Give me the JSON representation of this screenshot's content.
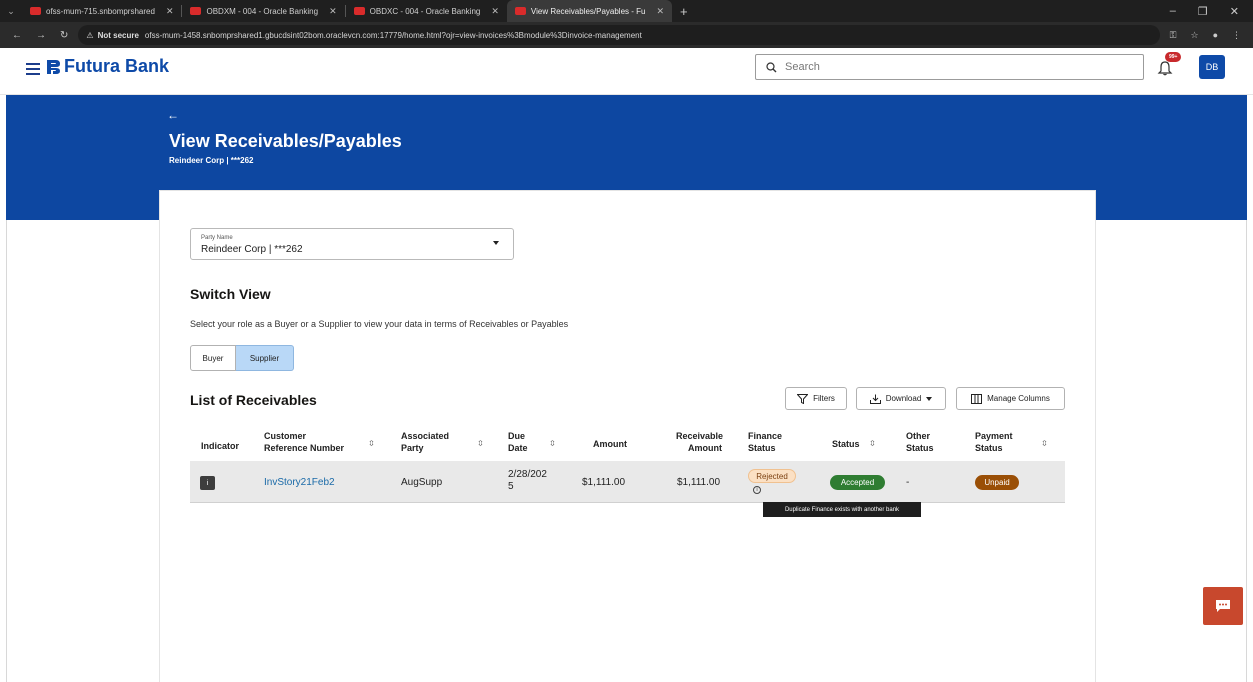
{
  "browser": {
    "tabs": [
      {
        "title": "ofss-mum-715.snbomprshared",
        "active": false
      },
      {
        "title": "OBDXM - 004 - Oracle Banking",
        "active": false
      },
      {
        "title": "OBDXC - 004 - Oracle Banking",
        "active": false
      },
      {
        "title": "View Receivables/Payables - Fu",
        "active": true
      }
    ],
    "not_secure": "Not secure",
    "url": "ofss-mum-1458.snbomprshared1.gbucdsint02bom.oraclevcn.com:17779/home.html?ojr=view-invoices%3Bmodule%3Dinvoice-management"
  },
  "header": {
    "brand": "Futura Bank",
    "search_placeholder": "Search",
    "notification_count": "99+",
    "avatar_initials": "DB"
  },
  "page": {
    "back": "←",
    "title": "View Receivables/Payables",
    "subtitle": "Reindeer Corp | ***262"
  },
  "party": {
    "label": "Party Name",
    "value": "Reindeer Corp | ***262"
  },
  "switch_view": {
    "title": "Switch View",
    "description": "Select your role as a Buyer or a Supplier to view your data in terms of Receivables or Payables",
    "buyer_label": "Buyer",
    "supplier_label": "Supplier",
    "selected": "Supplier"
  },
  "list": {
    "title": "List of Receivables",
    "filters_label": "Filters",
    "download_label": "Download",
    "manage_columns_label": "Manage Columns"
  },
  "table": {
    "headers": {
      "indicator": "Indicator",
      "customer_ref_1": "Customer",
      "customer_ref_2": "Reference Number",
      "associated_1": "Associated",
      "associated_2": "Party",
      "due_1": "Due",
      "due_2": "Date",
      "amount": "Amount",
      "receivable_1": "Receivable",
      "receivable_2": "Amount",
      "finance_1": "Finance",
      "finance_2": "Status",
      "status": "Status",
      "other_1": "Other",
      "other_2": "Status",
      "payment_1": "Payment",
      "payment_2": "Status"
    },
    "rows": [
      {
        "indicator": "i",
        "customer_ref": "InvStory21Feb2",
        "associated_party": "AugSupp",
        "due_date_1": "2/28/202",
        "due_date_2": "5",
        "amount": "$1,111.00",
        "receivable_amount": "$1,111.00",
        "finance_status": "Rejected",
        "status": "Accepted",
        "other_status": "-",
        "payment_status": "Unpaid"
      }
    ]
  },
  "tooltip": "Duplicate Finance exists with another bank",
  "colors": {
    "brand_blue": "#0d47a1",
    "link": "#1a6aa8",
    "accepted": "#2f7d32",
    "unpaid": "#9a4f06",
    "rejected_bg": "#fbe0c4",
    "chat": "#c8482d"
  }
}
